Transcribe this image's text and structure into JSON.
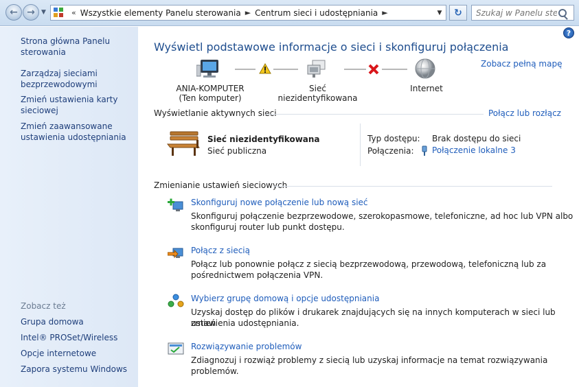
{
  "addressbar": {
    "crumb1": "Wszystkie elementy Panelu sterowania",
    "crumb2": "Centrum sieci i udostępniania",
    "search_placeholder": "Szukaj w Panelu ster..."
  },
  "sidebar": {
    "items": [
      "Strona główna Panelu sterowania",
      "Zarządzaj sieciami bezprzewodowymi",
      "Zmień ustawienia karty sieciowej",
      "Zmień zaawansowane ustawienia udostępniania"
    ],
    "see_also_label": "Zobacz też",
    "see_also": [
      "Grupa domowa",
      "Intel® PROSet/Wireless",
      "Opcje internetowe",
      "Zapora systemu Windows"
    ]
  },
  "main": {
    "title": "Wyświetl podstawowe informacje o sieci i skonfiguruj połączenia",
    "full_map_link": "Zobacz pełną mapę",
    "map": {
      "computer_name": "ANIA-KOMPUTER",
      "computer_sub": "(Ten komputer)",
      "network": "Sieć niezidentyfikowana",
      "internet": "Internet"
    },
    "active_networks": {
      "heading": "Wyświetlanie aktywnych sieci",
      "connect_link": "Połącz lub rozłącz",
      "network_name": "Sieć niezidentyfikowana",
      "network_type": "Sieć publiczna",
      "access_label": "Typ dostępu:",
      "access_value": "Brak dostępu do sieci",
      "connections_label": "Połączenia:",
      "connections_value": "Połączenie lokalne 3"
    },
    "change_settings": {
      "heading": "Zmienianie ustawień sieciowych",
      "tasks": [
        {
          "link": "Skonfiguruj nowe połączenie lub nową sieć",
          "desc1": "Skonfiguruj połączenie bezprzewodowe, szerokopasmowe, telefoniczne, ad hoc lub VPN albo",
          "desc2": "skonfiguruj router lub punkt dostępu."
        },
        {
          "link": "Połącz z siecią",
          "desc1": "Połącz lub ponownie połącz z siecią bezprzewodową, przewodową, telefoniczną lub za",
          "desc2": "pośrednictwem połączenia VPN."
        },
        {
          "link": "Wybierz grupę domową i opcje udostępniania",
          "desc1": "Uzyskaj dostęp do plików i drukarek znajdujących się na innych komputerach w sieci lub zmień",
          "desc2": "ustawienia udostępniania."
        },
        {
          "link": "Rozwiązywanie problemów",
          "desc1": "Zdiagnozuj i rozwiąż problemy z siecią lub uzyskaj informacje na temat rozwiązywania problemów.",
          "desc2": ""
        }
      ]
    }
  }
}
